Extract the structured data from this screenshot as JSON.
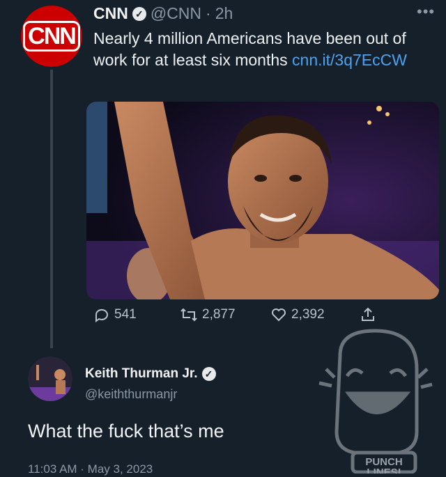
{
  "tweet": {
    "avatar_text": "CNN",
    "author_name": "CNN",
    "author_handle": "@CNN",
    "separator": "·",
    "age": "2h",
    "more_icon": "more-icon",
    "text": "Nearly 4 million Americans have been out of work for at least six months ",
    "link": "cnn.it/3q7EcCW",
    "stats": {
      "replies": "541",
      "retweets": "2,877",
      "likes": "2,392"
    }
  },
  "reply": {
    "author_name": "Keith Thurman Jr.",
    "author_handle": "@keiththurmanjr",
    "text": "What the fuck that’s me",
    "timestamp": "11:03 AM · May 3, 2023"
  },
  "watermark": {
    "label_line1": "PUNCH",
    "label_line2": "LINES!"
  },
  "colors": {
    "background": "#15202b",
    "link": "#4ba3ef",
    "cnn_red": "#cc0000",
    "muted": "#8b98a5"
  }
}
